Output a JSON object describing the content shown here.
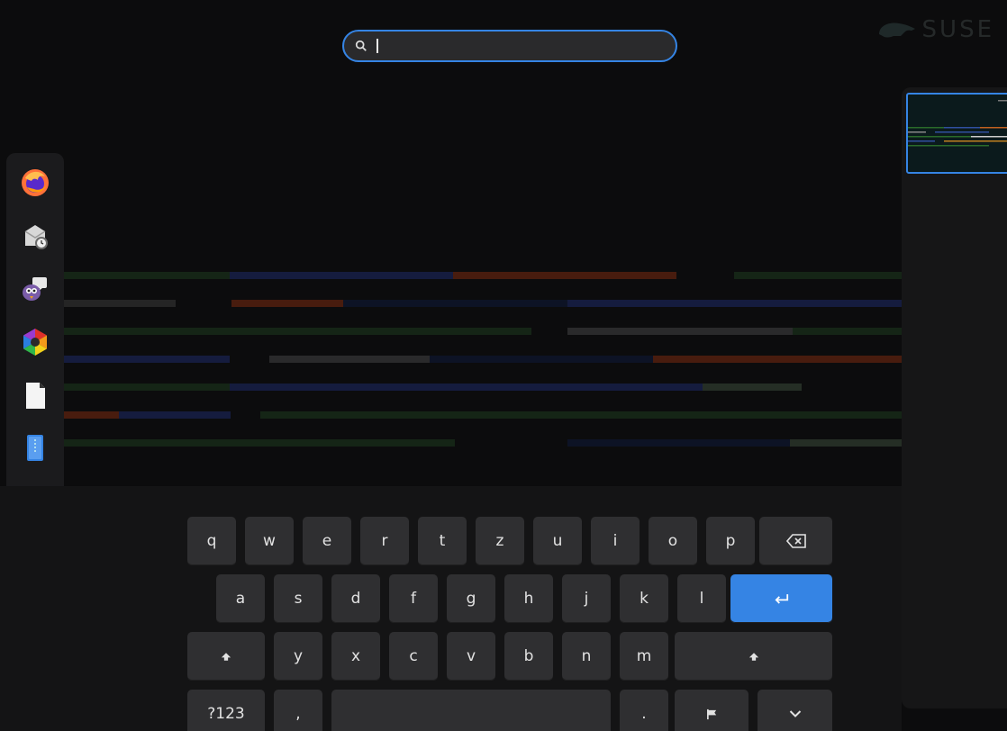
{
  "brand": {
    "logo_text": "SUSE"
  },
  "search": {
    "placeholder": "",
    "value": ""
  },
  "dock": {
    "items": [
      {
        "name": "firefox-icon"
      },
      {
        "name": "mail-clock-icon"
      },
      {
        "name": "chat-icon"
      },
      {
        "name": "color-app-icon"
      },
      {
        "name": "document-icon"
      },
      {
        "name": "text-editor-icon"
      },
      {
        "name": "file-manager-icon"
      },
      {
        "name": "help-icon"
      },
      {
        "name": "app-grid-icon"
      }
    ]
  },
  "keyboard": {
    "row1": [
      "q",
      "w",
      "e",
      "r",
      "t",
      "z",
      "u",
      "i",
      "o",
      "p"
    ],
    "row2": [
      "a",
      "s",
      "d",
      "f",
      "g",
      "h",
      "j",
      "k",
      "l"
    ],
    "row3": [
      "y",
      "x",
      "c",
      "v",
      "b",
      "n",
      "m"
    ],
    "row4": {
      "numbers": "?123",
      "comma": ",",
      "period": "."
    }
  },
  "colors": {
    "accent": "#3584e4",
    "key": "#2f2f31",
    "dock": "#1b1b1d"
  }
}
